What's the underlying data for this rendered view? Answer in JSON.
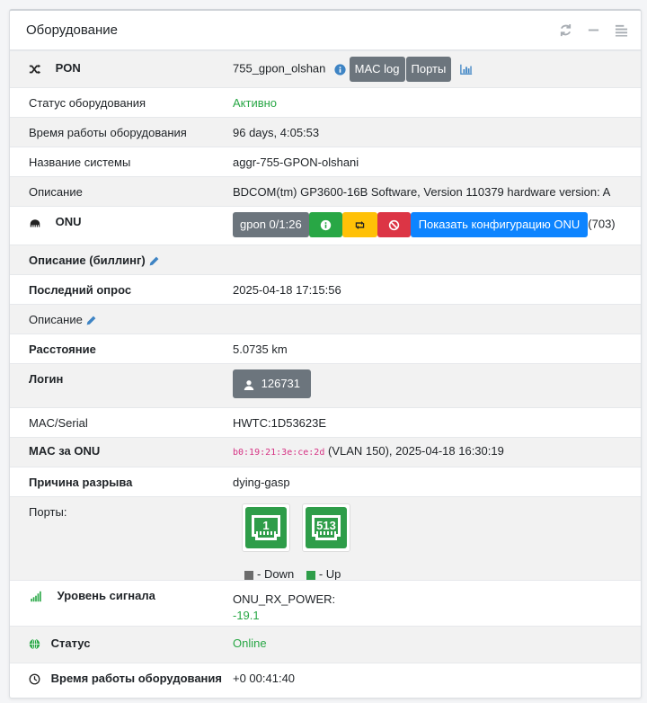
{
  "panel": {
    "title": "Оборудование"
  },
  "pon": {
    "label": "PON",
    "device": "755_gpon_olshan",
    "mac_log": "MAC log",
    "ports": "Порты"
  },
  "rows": {
    "status_label": "Статус оборудования",
    "status_value": "Активно",
    "uptime_label": "Время работы оборудования",
    "uptime_value": "96 days, 4:05:53",
    "sysname_label": "Название системы",
    "sysname_value": "aggr-755-GPON-olshani",
    "descr_label": "Описание",
    "descr_value": "BDCOM(tm) GP3600-16B Software, Version 110379 hardware version: A"
  },
  "onu": {
    "label": "ONU",
    "iface": "gpon 0/1:26",
    "show_config": "Показать конфигурацию ONU",
    "count": "(703)",
    "billing_label": "Описание (биллинг)",
    "last_poll_label": "Последний опрос",
    "last_poll_value": "2025-04-18 17:15:56",
    "descr_label": "Описание",
    "distance_label": "Расстояние",
    "distance_value": "5.0735 km",
    "login_label": "Логин",
    "login_value": "126731",
    "serial_label": "MAC/Serial",
    "serial_value": "HWTC:1D53623E",
    "mac_label": "MAC за ONU",
    "mac_value": "b0:19:21:3e:ce:2d",
    "mac_info": "(VLAN 150), 2025-04-18 16:30:19",
    "reason_label": "Причина разрыва",
    "reason_value": "dying-gasp",
    "ports_label": "Порты:",
    "port1": "1",
    "port2": "513",
    "legend_down": "- Down",
    "legend_up": "- Up",
    "signal_label": "Уровень сигнала",
    "signal_name": "ONU_RX_POWER:",
    "signal_value": "-19.1",
    "state_label": "Статус",
    "state_value": "Online",
    "uptime_label": "Время работы оборудования",
    "uptime_value": "+0 00:41:40"
  },
  "colors": {
    "green": "#28a745",
    "blue": "#0d84ff",
    "dark": "#6c757d",
    "yellow": "#ffc107",
    "red": "#dc3545"
  }
}
